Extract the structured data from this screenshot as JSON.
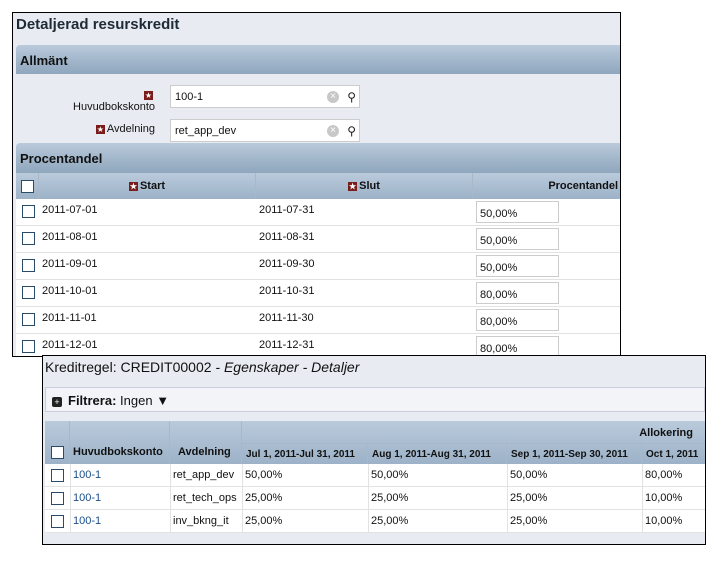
{
  "top": {
    "title": "Detaljerad resurskredit",
    "section_general": "Allmänt",
    "fields": [
      {
        "label": "Huvudbokskonto",
        "value": "100-1"
      },
      {
        "label": "Avdelning",
        "value": "ret_app_dev"
      }
    ],
    "section_percent": "Procentandel",
    "columns": [
      "Start",
      "Slut",
      "Procentandel"
    ],
    "rows": [
      [
        "2011-07-01",
        "2011-07-31",
        "50,00%"
      ],
      [
        "2011-08-01",
        "2011-08-31",
        "50,00%"
      ],
      [
        "2011-09-01",
        "2011-09-30",
        "50,00%"
      ],
      [
        "2011-10-01",
        "2011-10-31",
        "80,00%"
      ],
      [
        "2011-11-01",
        "2011-11-30",
        "80,00%"
      ],
      [
        "2011-12-01",
        "2011-12-31",
        "80,00%"
      ]
    ]
  },
  "bottom": {
    "title": "Kreditregel: CREDIT00002",
    "title_suffix": " - Egenskaper - Detaljer",
    "filter_label": "Filtrera:",
    "filter_value": "Ingen",
    "group_header": "Allokering",
    "columns": [
      "Huvudbokskonto",
      "Avdelning",
      "Jul 1, 2011-Jul 31, 2011",
      "Aug 1, 2011-Aug 31, 2011",
      "Sep 1, 2011-Sep 30, 2011",
      "Oct 1, 2011"
    ],
    "rows": [
      [
        "100-1",
        "ret_app_dev",
        "50,00%",
        "50,00%",
        "50,00%",
        "80,00%"
      ],
      [
        "100-1",
        "ret_tech_ops",
        "25,00%",
        "25,00%",
        "25,00%",
        "10,00%"
      ],
      [
        "100-1",
        "inv_bkng_it",
        "25,00%",
        "25,00%",
        "25,00%",
        "10,00%"
      ]
    ]
  }
}
